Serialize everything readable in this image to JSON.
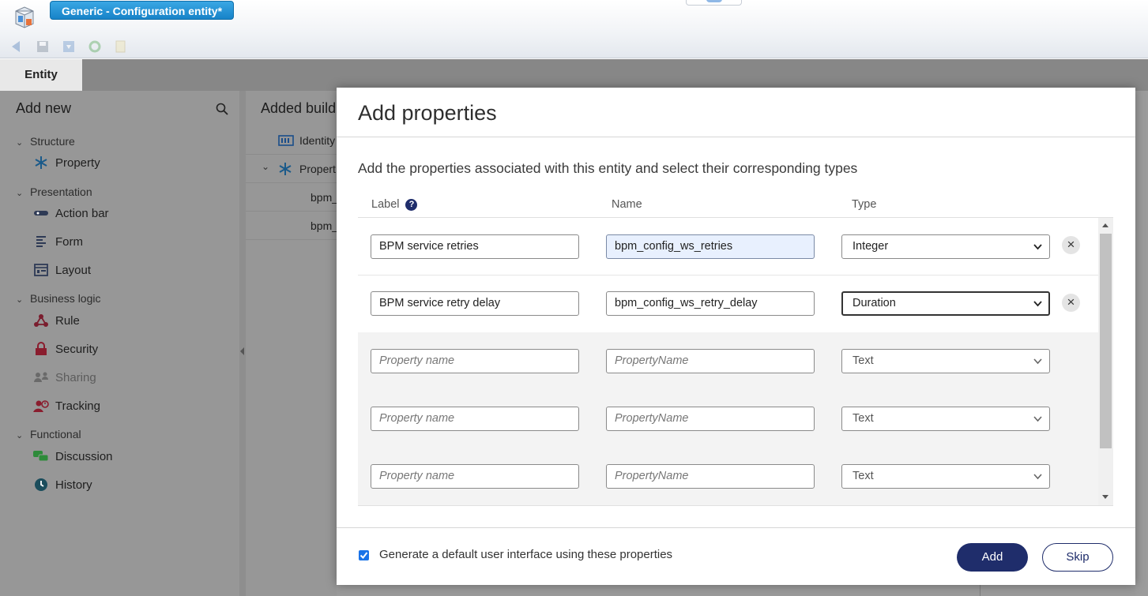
{
  "window": {
    "doc_tab": "Generic - Configuration entity*"
  },
  "tabs": {
    "entity": "Entity"
  },
  "sidebar": {
    "title": "Add new",
    "groups": [
      {
        "label": "Structure",
        "items": [
          {
            "label": "Property",
            "icon": "asterisk-icon"
          }
        ]
      },
      {
        "label": "Presentation",
        "items": [
          {
            "label": "Action bar",
            "icon": "action-bar-icon"
          },
          {
            "label": "Form",
            "icon": "form-icon"
          },
          {
            "label": "Layout",
            "icon": "layout-icon"
          }
        ]
      },
      {
        "label": "Business logic",
        "items": [
          {
            "label": "Rule",
            "icon": "rule-icon"
          },
          {
            "label": "Security",
            "icon": "lock-icon"
          },
          {
            "label": "Sharing",
            "icon": "sharing-icon"
          },
          {
            "label": "Tracking",
            "icon": "tracking-icon"
          }
        ]
      },
      {
        "label": "Functional",
        "items": [
          {
            "label": "Discussion",
            "icon": "discussion-icon"
          },
          {
            "label": "History",
            "icon": "history-icon"
          }
        ]
      }
    ]
  },
  "middle": {
    "title": "Added build",
    "rows": [
      "Identity",
      "Propert",
      "bpm_",
      "bpm_"
    ]
  },
  "modal": {
    "title": "Add properties",
    "description": "Add the properties associated with this entity and select their corresponding types",
    "columns": {
      "label": "Label",
      "name": "Name",
      "type": "Type"
    },
    "rows": [
      {
        "label": "BPM service retries",
        "name": "bpm_config_ws_retries",
        "type": "Integer"
      },
      {
        "label": "BPM service retry delay",
        "name": "bpm_config_ws_retry_delay",
        "type": "Duration"
      },
      {
        "label_placeholder": "Property name",
        "name_placeholder": "PropertyName",
        "type": "Text"
      },
      {
        "label_placeholder": "Property name",
        "name_placeholder": "PropertyName",
        "type": "Text"
      },
      {
        "label_placeholder": "Property name",
        "name_placeholder": "PropertyName",
        "type": "Text"
      }
    ],
    "checkbox_label": "Generate a default user interface using these properties",
    "checkbox_checked": true,
    "add_label": "Add",
    "skip_label": "Skip"
  },
  "colors": {
    "primary": "#1f2d6b",
    "tab_blue": "#1783c8",
    "checkbox": "#1a73e8"
  }
}
